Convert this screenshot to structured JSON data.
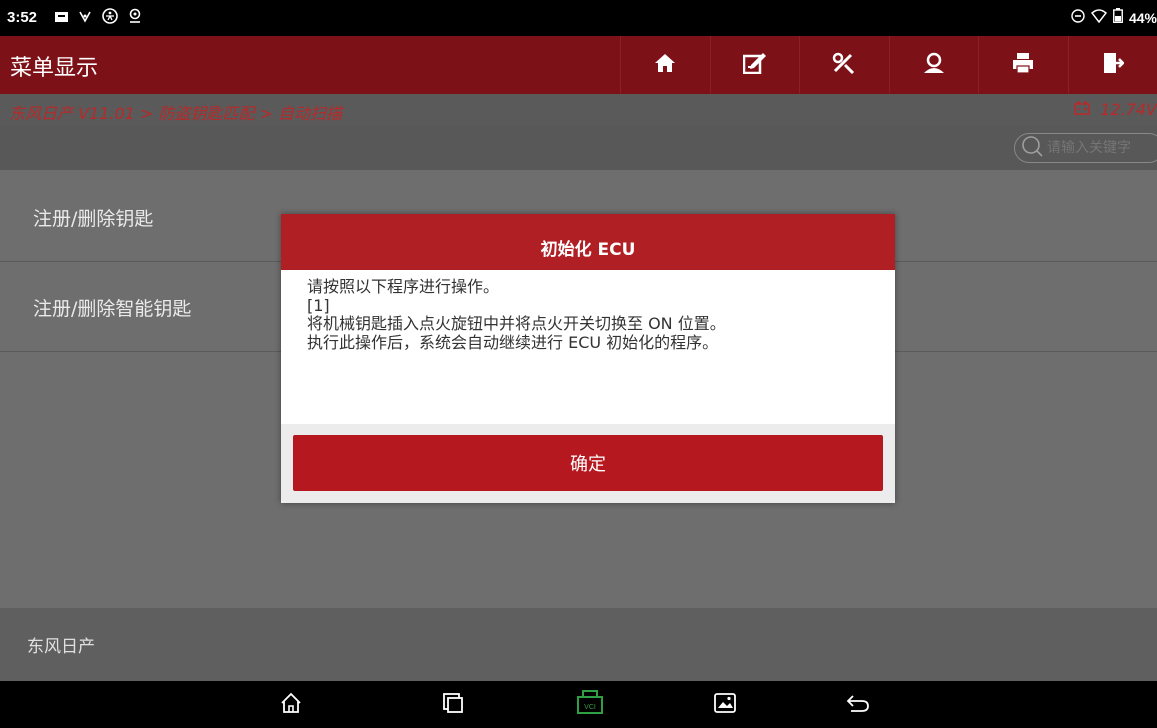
{
  "status_bar": {
    "time": "3:52",
    "battery": "44%",
    "left_icons": [
      "notification-icon",
      "usb-icon",
      "accessibility-icon",
      "location-icon"
    ],
    "right_icons": [
      "do-not-disturb-icon",
      "wifi-icon",
      "battery-icon"
    ]
  },
  "header": {
    "title": "菜单显示",
    "background": "#7d1118",
    "tools": [
      "home-icon",
      "edit-icon",
      "tools-icon",
      "user-icon",
      "print-icon",
      "exit-icon"
    ]
  },
  "breadcrumb": {
    "path": "东风日产 V11.01 > 防盗钥匙匹配 > 自动扫描",
    "voltage": "12.74V"
  },
  "search": {
    "placeholder": "请输入关键字"
  },
  "menu": {
    "items": [
      {
        "label": "注册/删除钥匙"
      },
      {
        "label": "注册/删除智能钥匙"
      }
    ]
  },
  "footer": {
    "text": "东风日产"
  },
  "dialog": {
    "title": "初始化 ECU",
    "lines": [
      "请按照以下程序进行操作。",
      "[1]",
      "将机械钥匙插入点火旋钮中并将点火开关切换至 ON 位置。",
      "执行此操作后，系统会自动继续进行 ECU 初始化的程序。"
    ],
    "ok_label": "确定",
    "accent": "#b01f24"
  },
  "navbar": {
    "buttons": [
      "home-nav-icon",
      "recents-icon",
      "vci-icon",
      "screenshot-icon",
      "back-icon"
    ],
    "vci_label": "VCI",
    "vci_color": "#2ea043"
  }
}
